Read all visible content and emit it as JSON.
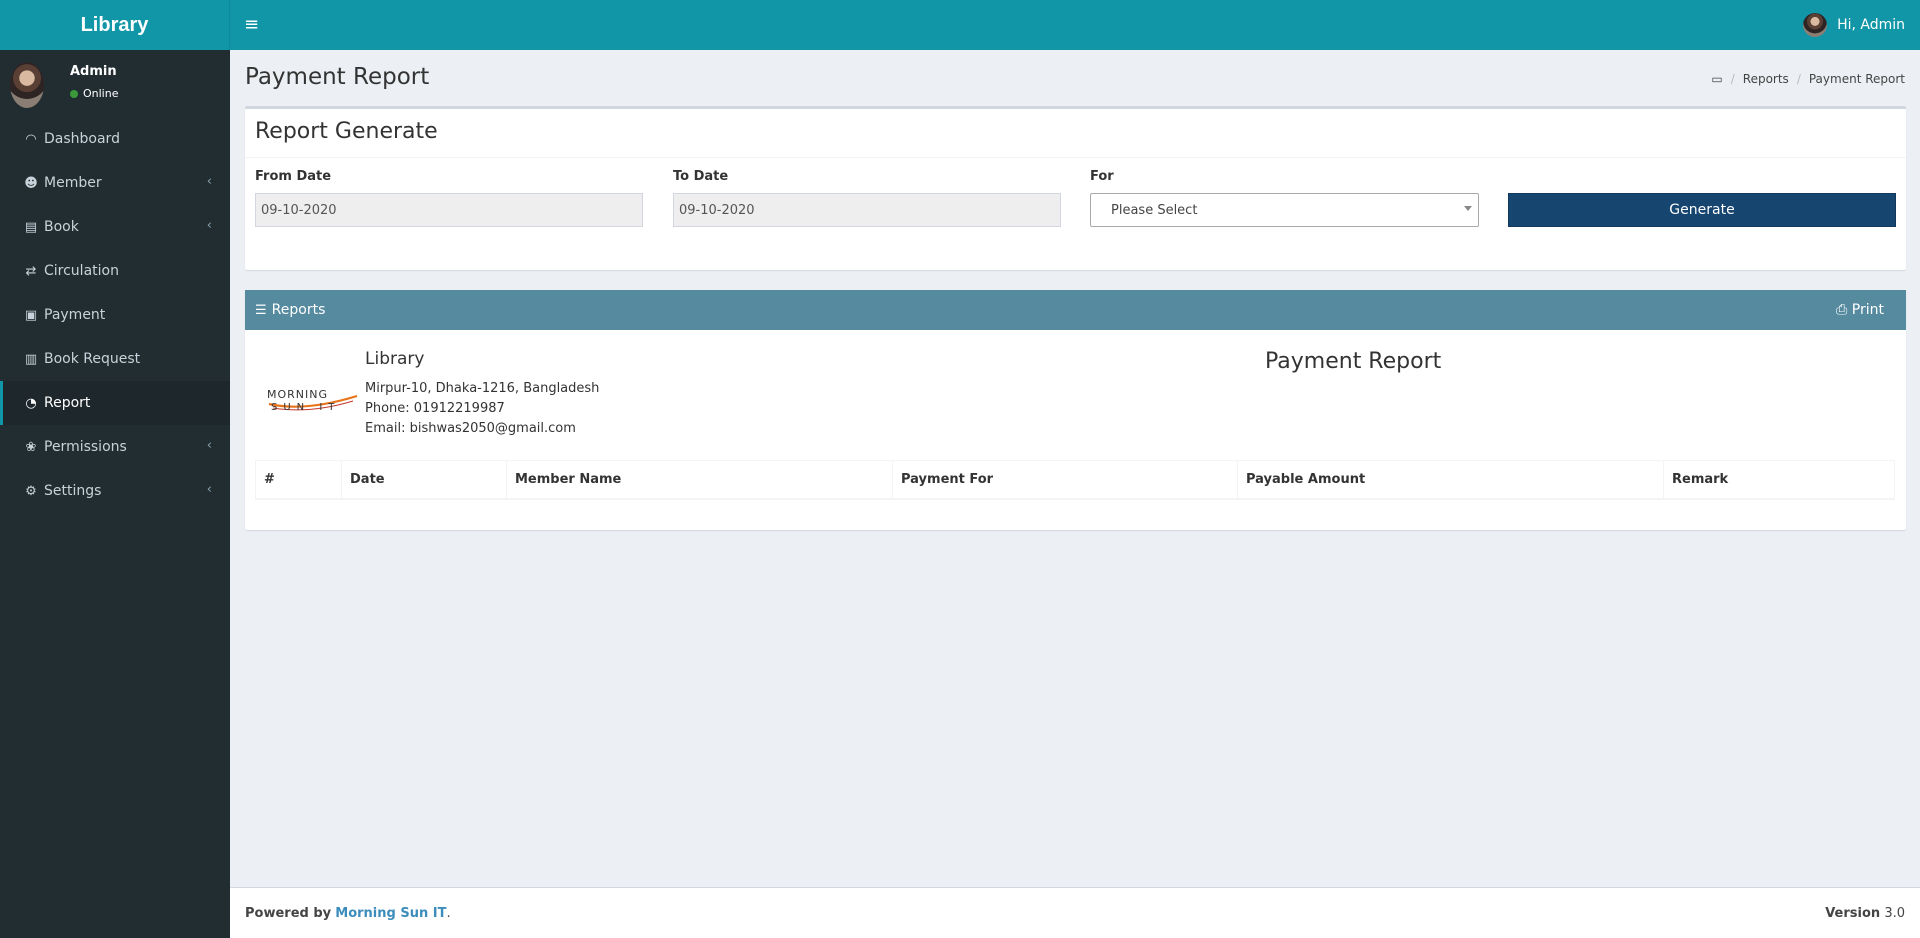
{
  "app": {
    "brand": "Library",
    "user_name": "Admin",
    "user_status": "Online",
    "greeting": "Hi, Admin"
  },
  "sidebar": {
    "items": [
      {
        "label": "Dashboard",
        "icon": "dashboard-icon",
        "glyph": "◠",
        "has_children": false,
        "active": false
      },
      {
        "label": "Member",
        "icon": "users-icon",
        "glyph": "☻",
        "has_children": true,
        "active": false
      },
      {
        "label": "Book",
        "icon": "book-icon",
        "glyph": "▤",
        "has_children": true,
        "active": false
      },
      {
        "label": "Circulation",
        "icon": "refresh-icon",
        "glyph": "⇄",
        "has_children": false,
        "active": false
      },
      {
        "label": "Payment",
        "icon": "money-icon",
        "glyph": "▣",
        "has_children": false,
        "active": false
      },
      {
        "label": "Book Request",
        "icon": "book-request-icon",
        "glyph": "▥",
        "has_children": false,
        "active": false
      },
      {
        "label": "Report",
        "icon": "pie-chart-icon",
        "glyph": "◔",
        "has_children": false,
        "active": true
      },
      {
        "label": "Permissions",
        "icon": "paw-icon",
        "glyph": "❀",
        "has_children": true,
        "active": false
      },
      {
        "label": "Settings",
        "icon": "gears-icon",
        "glyph": "⚙",
        "has_children": true,
        "active": false
      }
    ]
  },
  "header": {
    "page_title": "Payment Report",
    "breadcrumb": [
      "Reports",
      "Payment Report"
    ]
  },
  "form": {
    "title": "Report Generate",
    "from_label": "From Date",
    "from_value": "09-10-2020",
    "to_label": "To Date",
    "to_value": "09-10-2020",
    "for_label": "For",
    "for_value": "Please Select",
    "generate_label": "Generate"
  },
  "report": {
    "header_label": "Reports",
    "print_label": "Print",
    "logo_top": "MORNING",
    "logo_bottom": "SUN IT",
    "library_name": "Library",
    "address": "Mirpur-10, Dhaka-1216, Bangladesh",
    "phone": "Phone: 01912219987",
    "email": "Email: bishwas2050@gmail.com",
    "title": "Payment Report",
    "columns": [
      "#",
      "Date",
      "Member Name",
      "Payment For",
      "Payable Amount",
      "Remark"
    ]
  },
  "footer": {
    "powered_by": "Powered by",
    "company": "Morning Sun IT",
    "period": ".",
    "version_label": "Version",
    "version_value": "3.0"
  },
  "colors": {
    "topbar": "#1196a7",
    "sidebar": "#222d32",
    "report_header": "#558a9f",
    "generate_button": "#164570"
  }
}
